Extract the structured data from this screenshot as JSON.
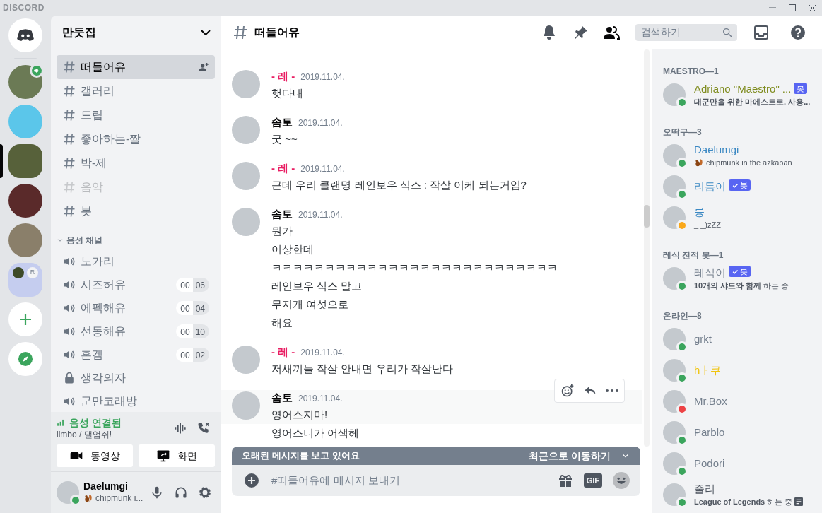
{
  "titlebar": {
    "brand": "DISCORD"
  },
  "servers": [
    {
      "kind": "home",
      "selected": false
    },
    {
      "kind": "server",
      "selected": false,
      "in_voice": true
    },
    {
      "kind": "server",
      "selected": false,
      "in_voice": false
    },
    {
      "kind": "server",
      "selected": true,
      "in_voice": false
    },
    {
      "kind": "server",
      "selected": false,
      "in_voice": false
    },
    {
      "kind": "server",
      "selected": false,
      "in_voice": false
    },
    {
      "kind": "folder",
      "selected": false,
      "label": "R"
    },
    {
      "kind": "add",
      "selected": false
    },
    {
      "kind": "explore",
      "selected": false
    }
  ],
  "guild": {
    "name": "만둣집"
  },
  "text_channels": [
    {
      "name": "떠들어유",
      "selected": true,
      "muted": false
    },
    {
      "name": "갤러리",
      "selected": false,
      "muted": false
    },
    {
      "name": "드립",
      "selected": false,
      "muted": false
    },
    {
      "name": "좋아하는-짤",
      "selected": false,
      "muted": false
    },
    {
      "name": "박-제",
      "selected": false,
      "muted": false
    },
    {
      "name": "음악",
      "selected": false,
      "muted": true
    },
    {
      "name": "봇",
      "selected": false,
      "muted": false
    }
  ],
  "voice_category": {
    "label": "음성 채널",
    "expanded": true
  },
  "voice_channels": [
    {
      "kind": "voice",
      "name": "노가리"
    },
    {
      "kind": "voice",
      "name": "시즈허유",
      "user_count": "00",
      "user_limit": "06"
    },
    {
      "kind": "voice",
      "name": "에펙해유",
      "user_count": "00",
      "user_limit": "04"
    },
    {
      "kind": "voice",
      "name": "선동해유",
      "user_count": "00",
      "user_limit": "10"
    },
    {
      "kind": "voice",
      "name": "혼겜",
      "user_count": "00",
      "user_limit": "02"
    },
    {
      "kind": "locked",
      "name": "생각의자"
    },
    {
      "kind": "voice",
      "name": "군만코래방"
    }
  ],
  "voice_status": {
    "title": "음성 연결됨",
    "detail": "limbo / 댈엄쥐!"
  },
  "media_buttons": [
    {
      "kind": "video",
      "label": "동영상"
    },
    {
      "kind": "screen",
      "label": "화면"
    }
  ],
  "user": {
    "name": "Daelumgi",
    "status": {
      "color": "#3ba55d"
    },
    "custom_status": "chipmunk i..."
  },
  "channel_header": {
    "name": "떠들어유",
    "search_placeholder": "검색하기"
  },
  "messages": [
    {
      "author": "- 레 -",
      "color": "#e91e63",
      "date": "2019.11.04.",
      "hovered": false,
      "lines": [
        "햇다내"
      ]
    },
    {
      "author": "솜토",
      "color": "#060607",
      "date": "2019.11.04.",
      "hovered": false,
      "lines": [
        "굿 ~~"
      ]
    },
    {
      "author": "- 레 -",
      "color": "#e91e63",
      "date": "2019.11.04.",
      "hovered": false,
      "lines": [
        "근데 우리 클랜명 레인보우 식스 : 작살 이케 되는거임?"
      ]
    },
    {
      "author": "솜토",
      "color": "#060607",
      "date": "2019.11.04.",
      "hovered": false,
      "lines": [
        "뭔가",
        "이상한데",
        "ㅋㅋㅋㅋㅋㅋㅋㅋㅋㅋㅋㅋㅋㅋㅋㅋㅋㅋㅋㅋㅋㅋㅋㅋㅋㅋㅋ",
        "레인보우 식스 말고",
        "무지개 여섯으로",
        "해요"
      ]
    },
    {
      "author": "- 레 -",
      "color": "#e91e63",
      "date": "2019.11.04.",
      "hovered": false,
      "lines": [
        "저새끼들 작살 안내면 우리가 작살난다"
      ]
    },
    {
      "author": "솜토",
      "color": "#060607",
      "date": "2019.11.04.",
      "hovered": true,
      "lines": [
        "영어스지마!",
        "영어스니가 어색헤"
      ]
    }
  ],
  "jump_bar": {
    "text": "오래된 메시지를 보고 있어요",
    "action": "최근으로 이동하기"
  },
  "composer": {
    "placeholder": "#떠들어유에 메시지 보내기",
    "gif": "GIF"
  },
  "member_groups": [
    {
      "title": "MAESTRO—1",
      "members": [
        {
          "name": "Adriano \"Maestro\" ...",
          "color": "#7f8c1f",
          "status": {
            "color": "#3ba55d"
          },
          "bot_tag": "봇",
          "verified": false,
          "activity": "대군만을 위한 마에스트로. 사용...",
          "activity_bold": true
        }
      ]
    },
    {
      "title": "오딱구—3",
      "members": [
        {
          "name": "Daelumgi",
          "color": "#3b88c3",
          "status": {
            "color": "#3ba55d"
          },
          "activity": "chipmunk in the azkaban",
          "activity_bold": false,
          "emoji": true
        },
        {
          "name": "리듬이",
          "color": "#3b88c3",
          "status": {
            "color": "#3ba55d"
          },
          "bot_tag": "봇",
          "verified": true
        },
        {
          "name": "륭",
          "color": "#3b88c3",
          "status": {
            "color": "#faa81a"
          },
          "activity": "_ _)zZZ",
          "activity_bold": false
        }
      ]
    },
    {
      "title": "레식 전적 봇—1",
      "members": [
        {
          "name": "레식이",
          "color": "#747f8d",
          "status": {
            "color": "#3ba55d"
          },
          "bot_tag": "봇",
          "verified": true,
          "activity": "**10개의 샤드와 함께** 하는 중",
          "activity_bold": false
        }
      ]
    },
    {
      "title": "온라인—8",
      "members": [
        {
          "name": "grkt",
          "color": "#747f8d",
          "status": {
            "color": "#3ba55d"
          }
        },
        {
          "name": "hㅏ쿠",
          "color": "#f1c40f",
          "status": {
            "color": "#3ba55d"
          }
        },
        {
          "name": "Mr.Box",
          "color": "#747f8d",
          "status": {
            "color": "#ed4245"
          }
        },
        {
          "name": "Parblo",
          "color": "#747f8d",
          "status": {
            "color": "#3ba55d"
          }
        },
        {
          "name": "Podori",
          "color": "#747f8d",
          "status": {
            "color": "#3ba55d"
          }
        },
        {
          "name": "줄리",
          "color": "#4f5660",
          "status": {
            "color": "#3ba55d"
          },
          "activity": "**League of Legends** 하는 중",
          "activity_bold": false,
          "rich_presence": true
        }
      ]
    }
  ]
}
